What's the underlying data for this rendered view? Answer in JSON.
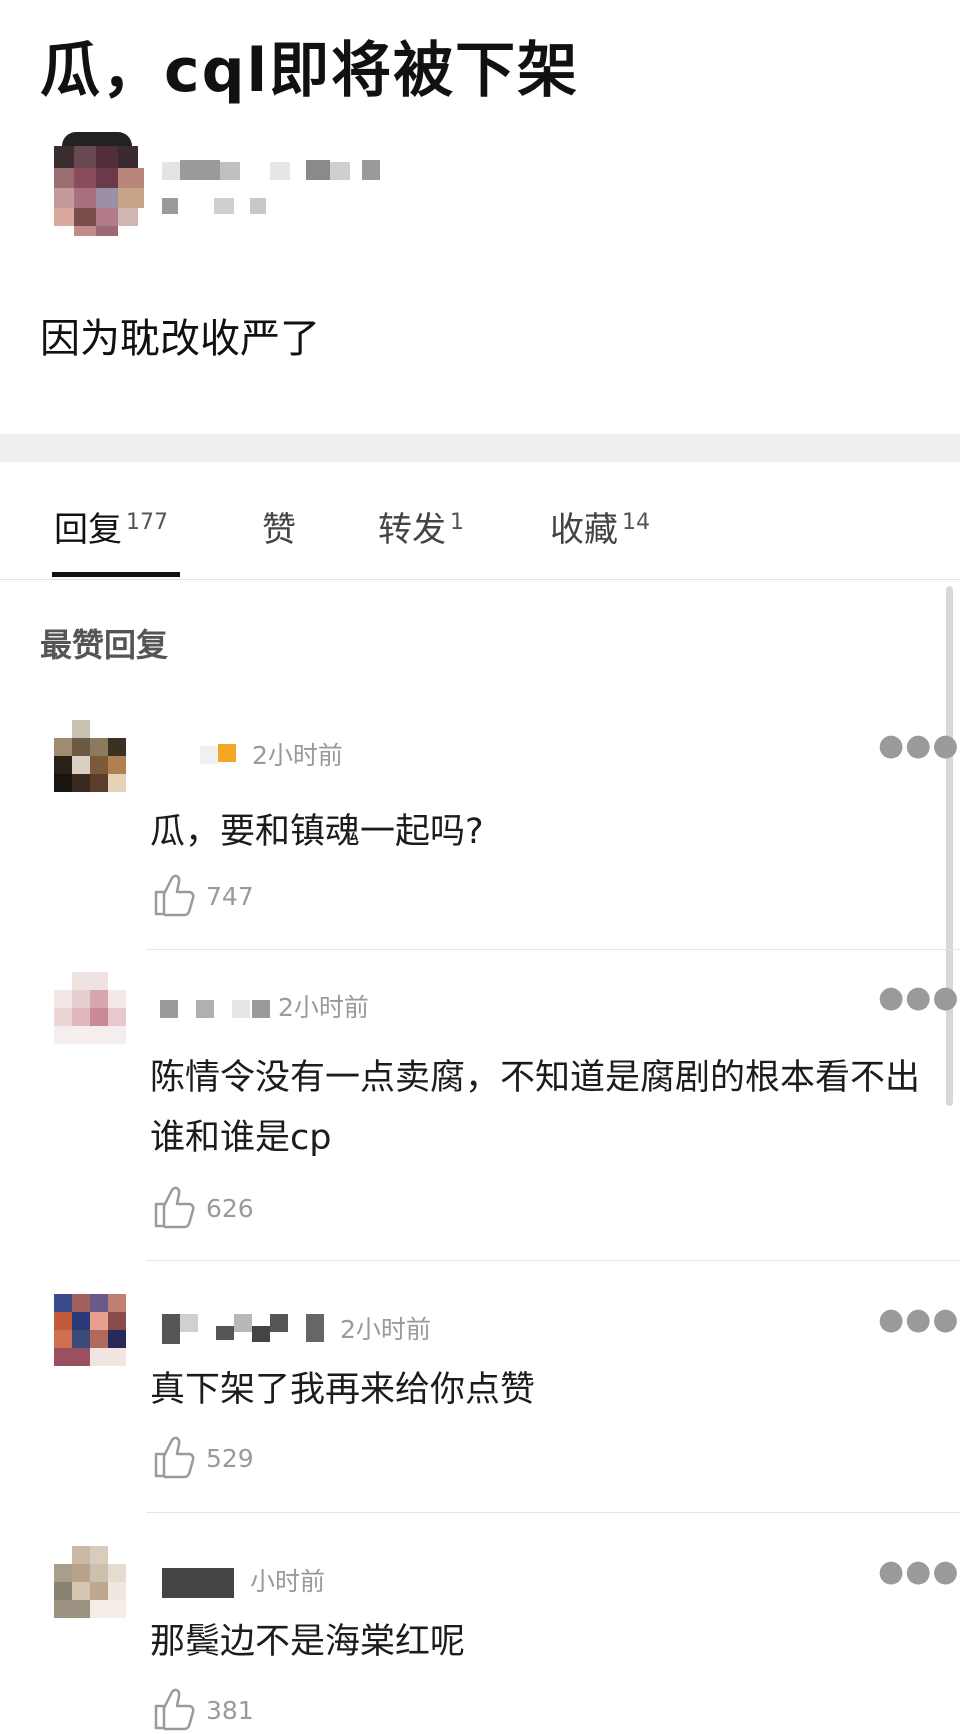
{
  "post": {
    "title": "瓜，cql即将被下架",
    "body": "因为耽改收严了"
  },
  "tabs": [
    {
      "label": "回复",
      "count": "177"
    },
    {
      "label": "赞",
      "count": ""
    },
    {
      "label": "转发",
      "count": "1"
    },
    {
      "label": "收藏",
      "count": "14"
    }
  ],
  "section_label": "最赞回复",
  "more_icon": "more-dots-icon",
  "like_icon": "thumbs-up-icon",
  "comments": [
    {
      "time": "2小时前",
      "text": "瓜，要和镇魂一起吗?",
      "likes": "747"
    },
    {
      "time": "2小时前",
      "text": "陈情令没有一点卖腐，不知道是腐剧的根本看不出谁和谁是cp",
      "likes": "626"
    },
    {
      "time": "2小时前",
      "text": "真下架了我再来给你点赞",
      "likes": "529"
    },
    {
      "time": "小时前",
      "text": "那鬓边不是海棠红呢",
      "likes": "381"
    }
  ],
  "colors": {
    "accent": "#111111",
    "muted": "#9a9a9a",
    "band": "#eeeeec",
    "badge": "#f5a623"
  }
}
